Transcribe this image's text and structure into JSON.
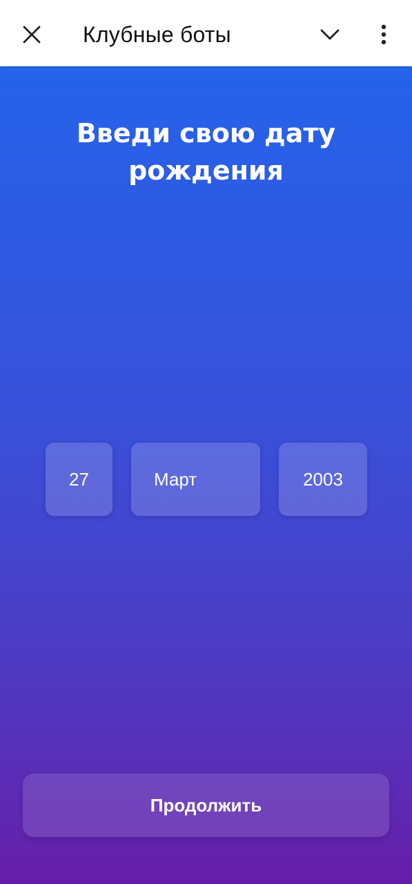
{
  "header": {
    "title": "Клубные боты",
    "close_icon": "close-icon",
    "collapse_icon": "chevron-down-icon",
    "menu_icon": "more-vertical-icon"
  },
  "main": {
    "heading": "Введи свою дату рождения",
    "birthdate": {
      "day": "27",
      "month": "Март",
      "year": "2003"
    },
    "continue_label": "Продолжить"
  },
  "colors": {
    "gradient_top": "#2563ea",
    "gradient_bottom": "#661ea8",
    "header_background": "#ffffff",
    "text_on_gradient": "#ffffff"
  }
}
